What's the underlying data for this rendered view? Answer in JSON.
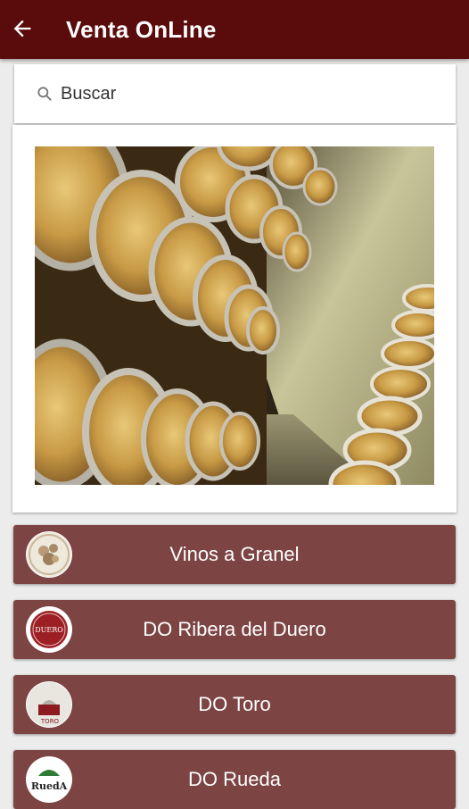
{
  "appbar": {
    "title": "Venta OnLine",
    "back_icon": "arrow-left-icon"
  },
  "search": {
    "placeholder": "Buscar",
    "icon": "search-icon"
  },
  "banner": {
    "description": "wine-barrels-cellar"
  },
  "categories": [
    {
      "label": "Vinos a Granel",
      "logo": "vinos-granel-logo"
    },
    {
      "label": "DO Ribera del Duero",
      "logo": "ribera-duero-logo",
      "logo_text": "DUERO"
    },
    {
      "label": "DO Toro",
      "logo": "toro-logo",
      "logo_text": "TORO"
    },
    {
      "label": "DO Rueda",
      "logo": "rueda-logo",
      "logo_text": "RuedA"
    }
  ],
  "colors": {
    "appbar": "#5a0c0c",
    "button": "#7d4444",
    "background": "#ececec"
  }
}
